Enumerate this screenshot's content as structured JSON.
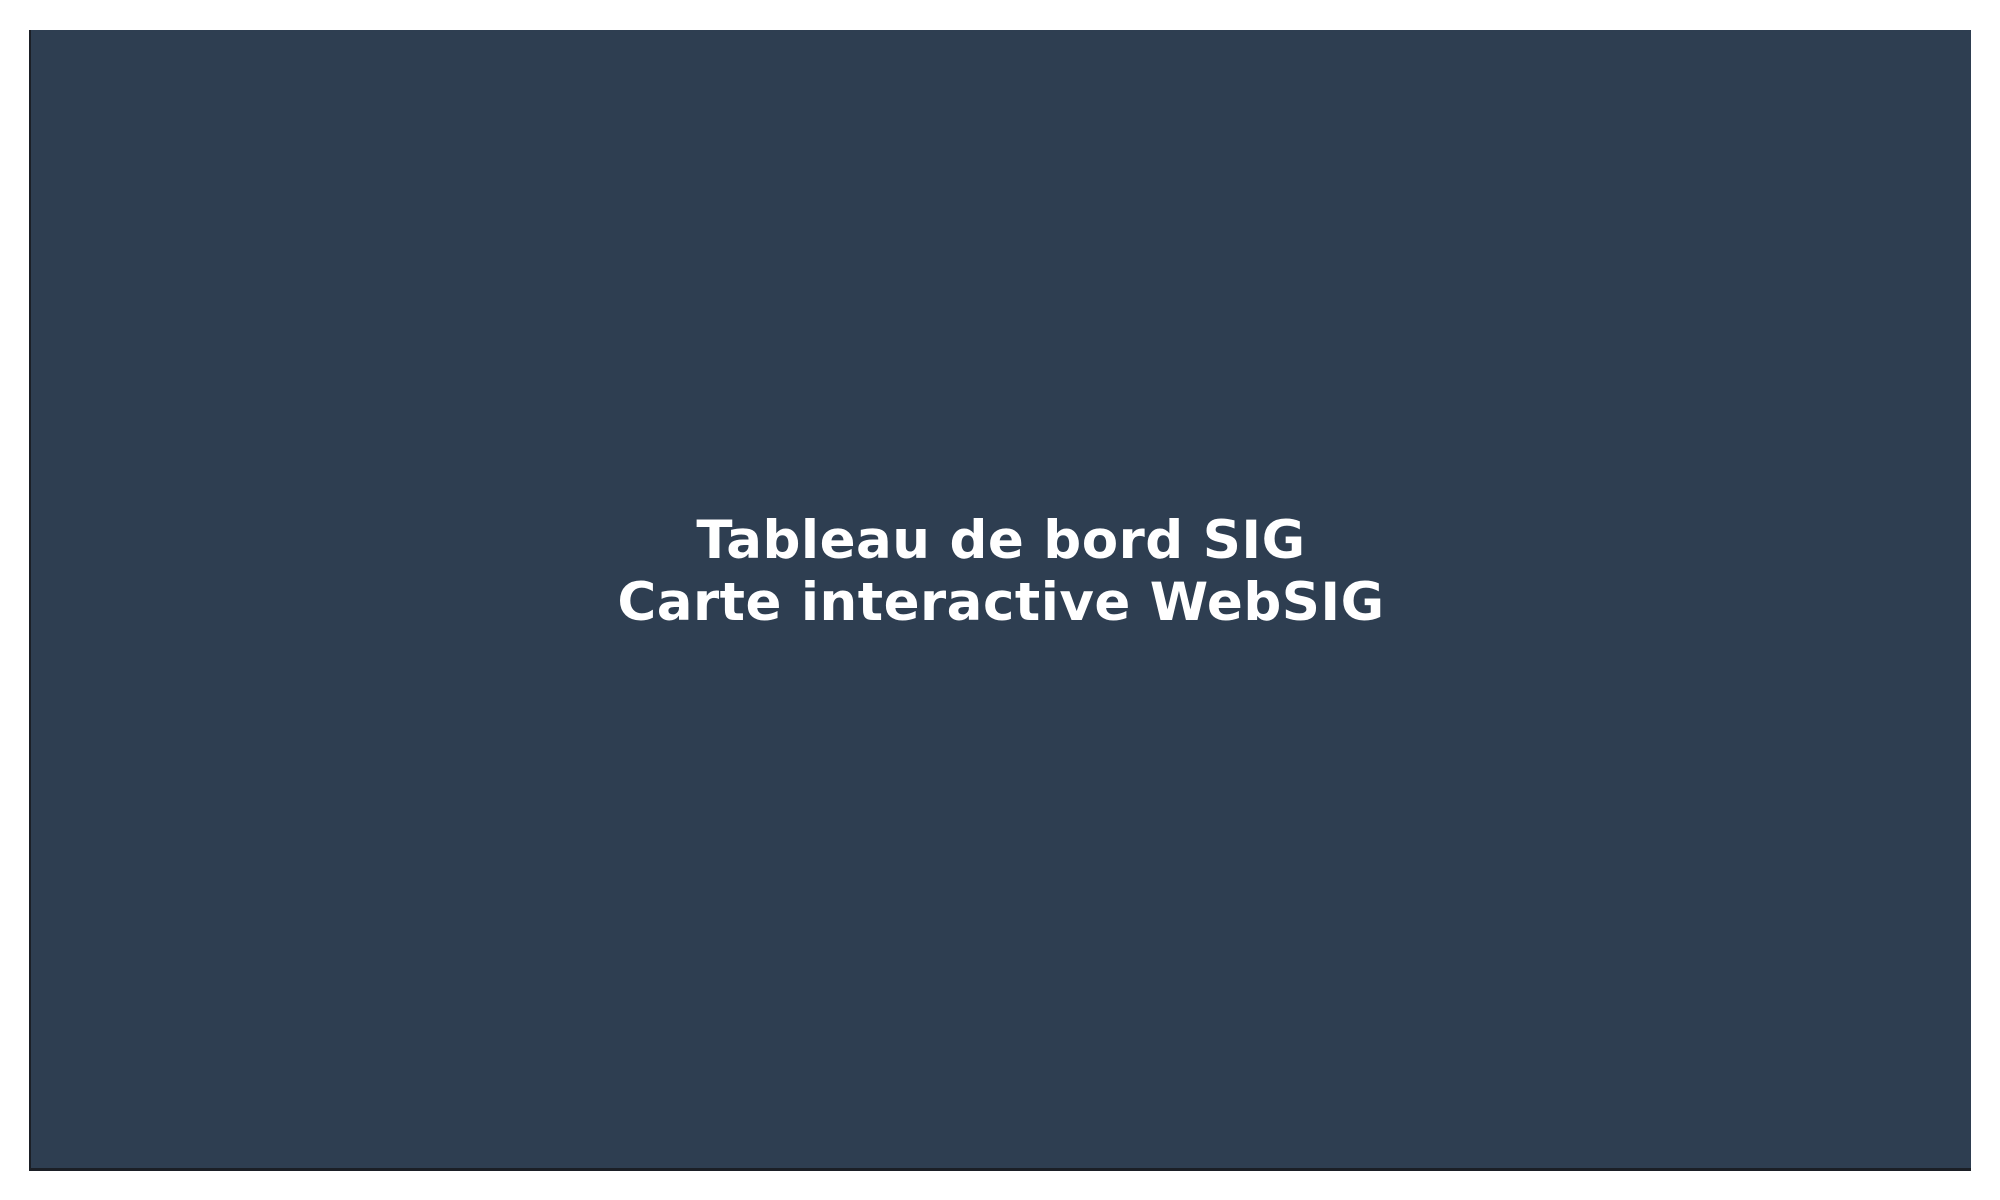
{
  "dashboard": {
    "title": "Tableau de bord SIG",
    "subtitle": "Carte interactive WebSIG"
  },
  "colors": {
    "panel_background": "#2e3e51",
    "text": "#ffffff",
    "page_background": "#ffffff",
    "border": "#1b1f26"
  }
}
